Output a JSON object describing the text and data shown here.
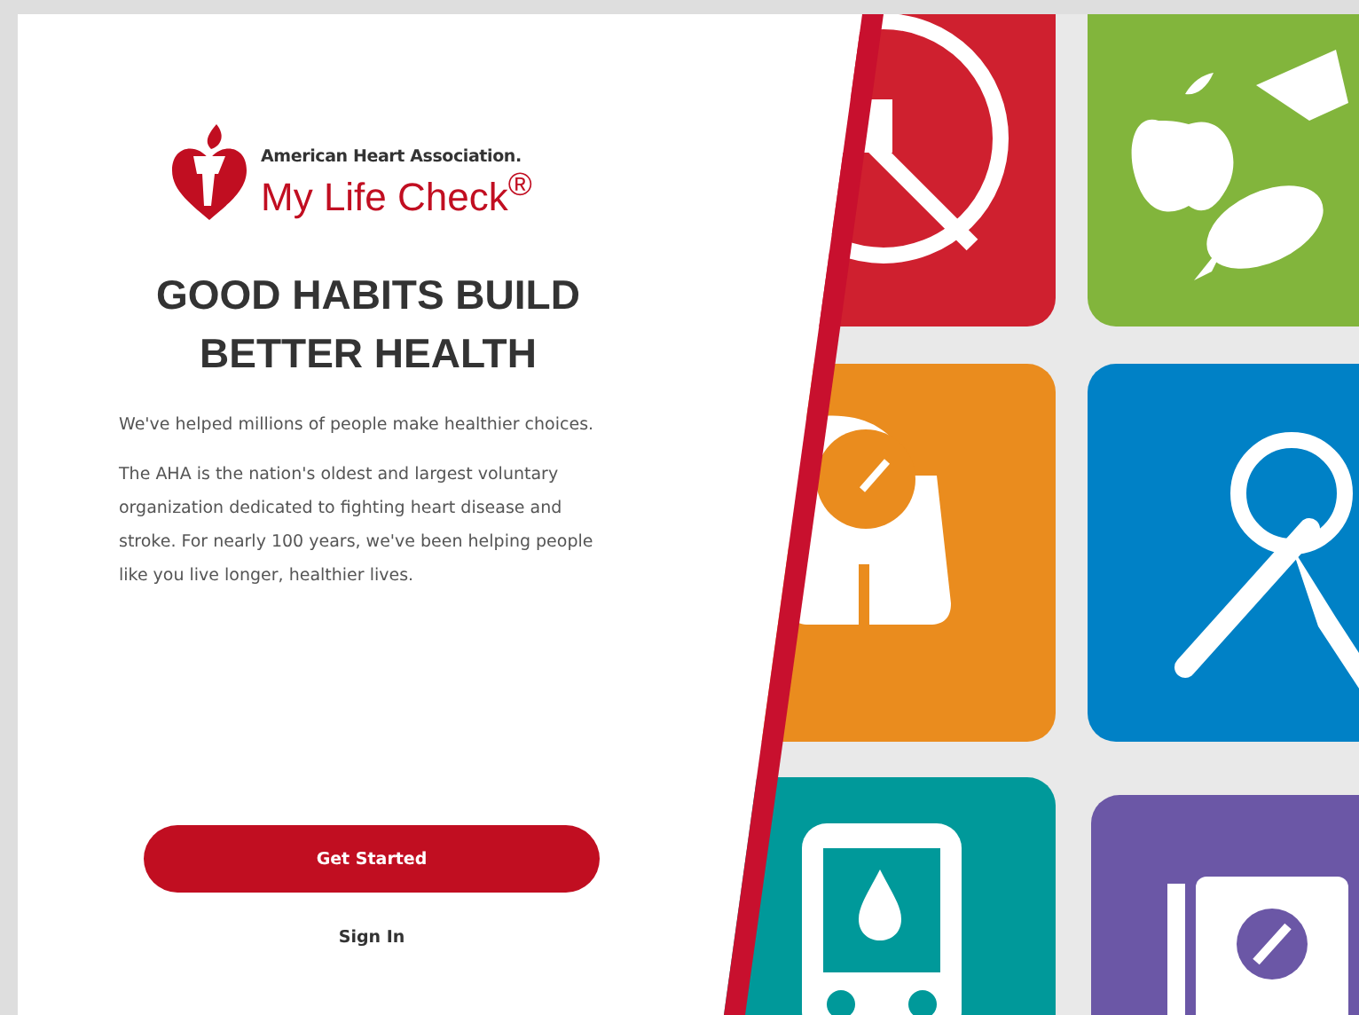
{
  "logo": {
    "organization": "American Heart Association.",
    "product": "My Life Check$^{®}$"
  },
  "headline": "GOOD HABITS BUILD BETTER HEALTH",
  "paragraphs": [
    "We've helped millions of people make healthier choices.",
    "The AHA is the nation's oldest and largest voluntary organization dedicated to fighting heart disease and stroke. For nearly 100 years, we've been helping people like you live longer, healthier lives."
  ],
  "buttons": [
    {
      "label": "Get Started",
      "kind": "primary"
    },
    {
      "label": "Sign In",
      "kind": "link"
    }
  ]
}
